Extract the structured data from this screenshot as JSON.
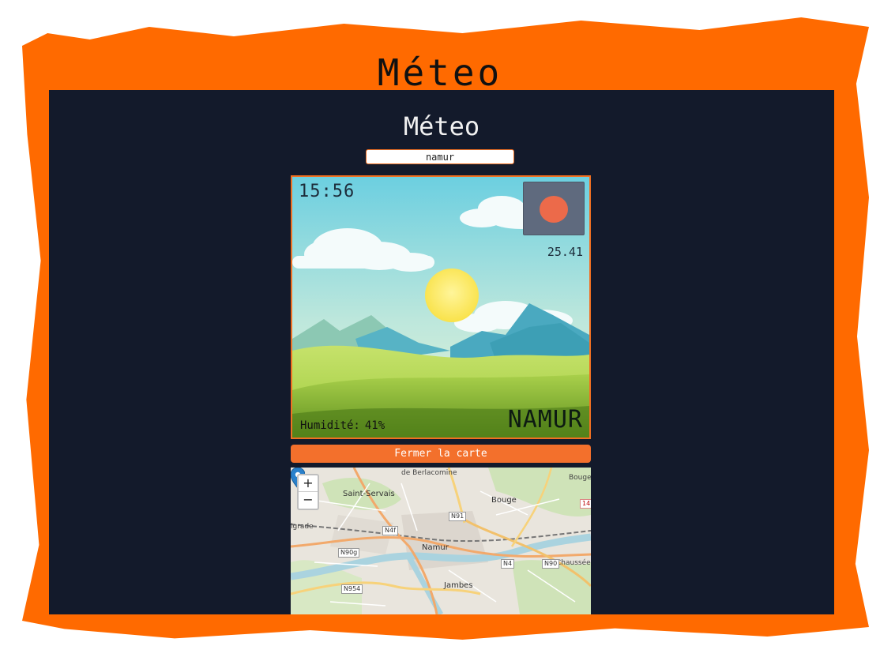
{
  "frame": {
    "title": "Méteo"
  },
  "app": {
    "title": "Méteo",
    "search": {
      "value": "namur"
    }
  },
  "weather": {
    "time": "15:56",
    "temperature": "25.41",
    "humidity_label": "Humidité:",
    "humidity_value": "41%",
    "city": "NAMUR",
    "icon": "sun-icon"
  },
  "map_button": {
    "label": "Fermer la carte"
  },
  "map": {
    "zoom_in": "+",
    "zoom_out": "−",
    "places": {
      "berlacomine": "de Berlacomine",
      "saint_servais": "Saint-Servais",
      "bouge": "Bouge",
      "bouge_ch": "Bouge",
      "belgrade": "lgrade",
      "namur": "Namur",
      "jambes": "Jambes",
      "chaussee": "Chaussée de"
    },
    "roads": {
      "n91": "N91",
      "n4f": "N4f",
      "n90g": "N90g",
      "n4": "N4",
      "n90": "N90",
      "n954": "N954",
      "n14": "14"
    }
  },
  "colors": {
    "accent": "#ff6a00",
    "panel": "#131a2b",
    "button": "#f3702c"
  }
}
